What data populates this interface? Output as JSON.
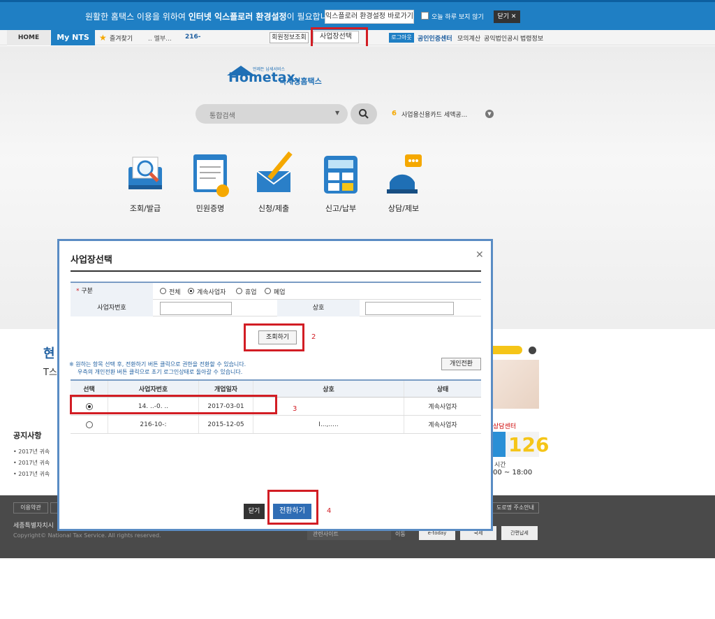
{
  "banner": {
    "text_pre": "원활한 홈택스 이용을 위하여 ",
    "text_bold": "인터넷 익스플로러 환경설정",
    "text_post": "이 필요합니다.",
    "settings_button": "익스플로러 환경설정 바로가기",
    "dont_show": "오늘 하루 보지 않기",
    "close": "닫기 ✕"
  },
  "nav": {
    "home": "HOME",
    "mynts": "My NTS",
    "favorites": "즐겨찾기",
    "user_name": "  .. 멜부...",
    "user_no": "216-",
    "member_info": "회원정보조회",
    "business_select": "사업장선택",
    "logout": "로그아웃",
    "cert_center": "공인인증센터",
    "links": [
      "모의계산",
      "공익법인공시",
      "법령정보"
    ]
  },
  "logo": {
    "brand": "Hometax.",
    "sub": "국세청홈택스",
    "tiny": "언제든 납세서비스"
  },
  "search": {
    "placeholder": "통합검색"
  },
  "ticker": {
    "num": "6",
    "text": "사업용신용카드 세액공..."
  },
  "menu": [
    {
      "label": "조회/발급",
      "icon": "search-document-icon"
    },
    {
      "label": "민원증명",
      "icon": "certificate-icon"
    },
    {
      "label": "신청/제출",
      "icon": "envelope-pen-icon"
    },
    {
      "label": "신고/납부",
      "icon": "calculator-icon"
    },
    {
      "label": "상담/제보",
      "icon": "chat-bubble-icon"
    }
  ],
  "lower": {
    "title": "현",
    "sub": "T스",
    "notice_title": "공지사항",
    "notices": [
      "2017년 귀속",
      "2017년 귀속",
      "2017년 귀속"
    ]
  },
  "right_panel": {
    "center": "상담센터",
    "number": "126",
    "time_label": "시간",
    "hours": "00 ~ 18:00"
  },
  "footer": {
    "terms": "이용약관",
    "address": "세종특별자치시",
    "copyright": "Copyright© National Tax Service. All rights reserved.",
    "road_addr": "도로명 주소안내",
    "search_placeholder": "관련사이트",
    "go": "이동",
    "badges": [
      "e-today",
      "국세",
      "간편납세"
    ]
  },
  "modal": {
    "title": "사업장선택",
    "close_x": "✕",
    "form": {
      "type_label": "구분",
      "required_mark": "*",
      "options": [
        "전체",
        "계속사업자",
        "휴업",
        "폐업"
      ],
      "selected_option": "계속사업자",
      "bizno_label": "사업자번호",
      "bizno_value": "",
      "name_label": "상호",
      "name_value": ""
    },
    "search_button": "조회하기",
    "help_line1": "※ 원하는 항목 선택 후, 전환하기 버튼 클릭으로 권한을 전환할 수 있습니다.",
    "help_line2": "우측의 개인전환 버튼 클릭으로 초기 로그인상태로 돌아갈 수 있습니다.",
    "personal_button": "개인전환",
    "columns": [
      "선택",
      "사업자번호",
      "개업일자",
      "상호",
      "상태"
    ],
    "rows": [
      {
        "selected": true,
        "bizno": "14. ..-0. ..",
        "open_date": "2017-03-01",
        "name": "",
        "status": "계속사업자"
      },
      {
        "selected": false,
        "bizno": "216-10-:",
        "open_date": "2015-12-05",
        "name": "I...,.....",
        "status": "계속사업자"
      }
    ],
    "close_button": "닫기",
    "switch_button": "전환하기"
  },
  "annotations": [
    "1",
    "2",
    "3",
    "4"
  ],
  "colors": {
    "accent": "#1f7fc4",
    "annotation": "#d21d24",
    "modal_border": "#5a8cc4"
  }
}
